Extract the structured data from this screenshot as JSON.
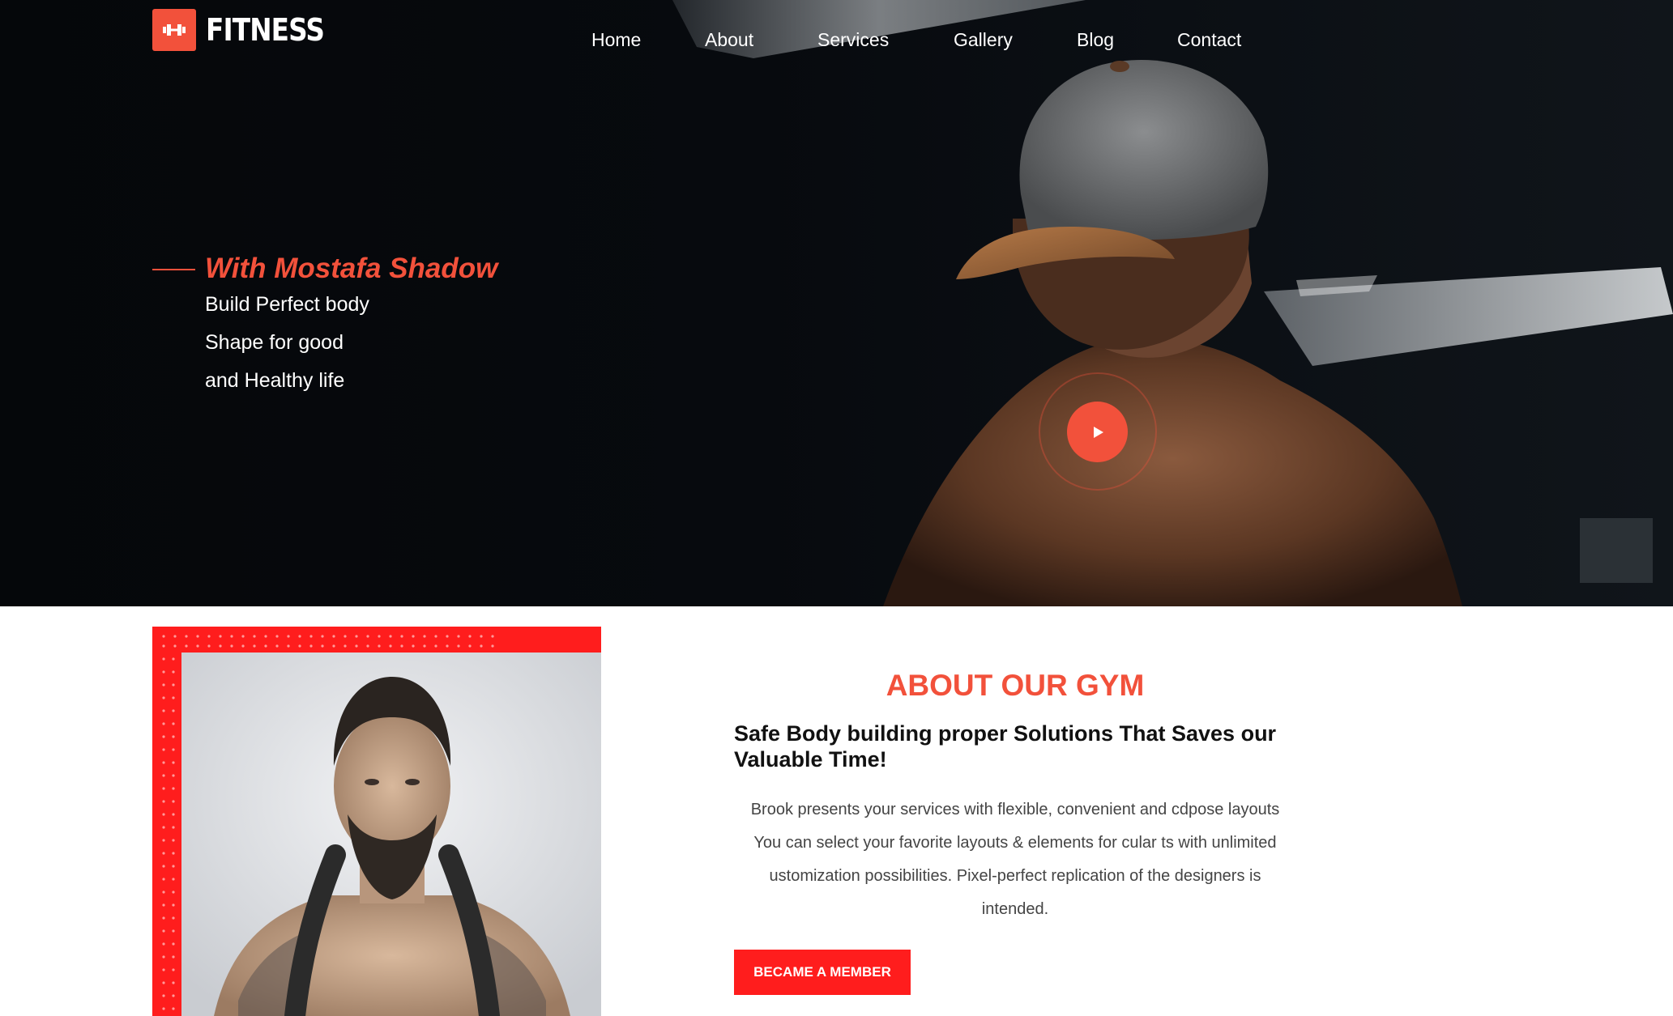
{
  "colors": {
    "accent": "#f2513b",
    "member_red": "#ff1d1d",
    "hero_bg": "#07090d"
  },
  "brand": {
    "name": "FITNESS",
    "logo_icon": "dumbbell-icon"
  },
  "nav": {
    "items": [
      {
        "label": "Home"
      },
      {
        "label": "About"
      },
      {
        "label": "Services"
      },
      {
        "label": "Gallery"
      },
      {
        "label": "Blog"
      },
      {
        "label": "Contact"
      }
    ]
  },
  "hero": {
    "tagline": "With Mostafa Shadow",
    "lines": [
      "Build Perfect body",
      "Shape for good",
      "and Healthy life"
    ],
    "play_icon": "play-icon"
  },
  "about": {
    "title": "ABOUT OUR GYM",
    "subtitle": "Safe Body building proper Solutions That Saves our Valuable Time!",
    "body_lines": [
      "Brook presents your services with flexible, convenient and cdpose layouts",
      "You can select your favorite layouts & elements for cular ts with unlimited",
      "ustomization possibilities. Pixel-perfect replication of the designers is",
      "intended."
    ],
    "button_label": "BECAME A MEMBER"
  }
}
